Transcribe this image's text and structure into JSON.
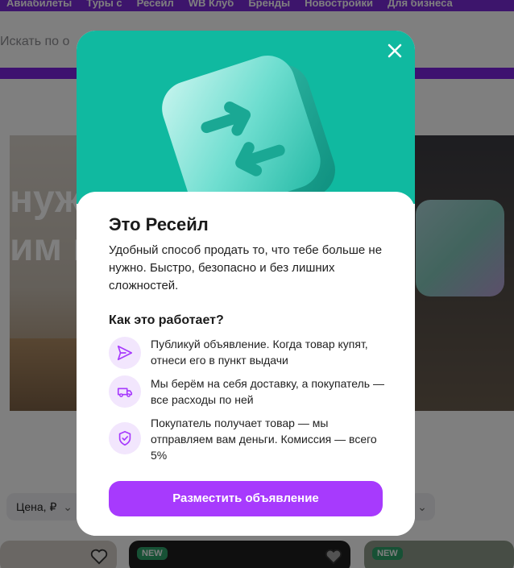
{
  "nav": {
    "items": [
      "Авиабилеты",
      "Туры с",
      "Ресейл",
      "WB Клуб",
      "Бренды",
      "Новостройки",
      "Для бизнеса"
    ]
  },
  "search": {
    "placeholder": "Искать по о"
  },
  "hero": {
    "line1": "нуж",
    "line2": "им в"
  },
  "filters": {
    "price_label": "Цена, ₽"
  },
  "cards": {
    "new_badge": "NEW"
  },
  "modal": {
    "title": "Это Ресейл",
    "description": "Удобный способ продать то, что тебе больше не нужно. Быстро, безопасно и без лишних сложностей.",
    "how_title": "Как это работает?",
    "steps": [
      {
        "icon": "send-icon",
        "text": "Публикуй объявление. Когда товар купят, отнеси его в пункт выдачи"
      },
      {
        "icon": "delivery-truck-icon",
        "text": "Мы берём на себя доставку, а покупатель — все расходы по ней"
      },
      {
        "icon": "shield-check-icon",
        "text": "Покупатель получает товар — мы отправляем вам деньги. Комиссия — всего 5%"
      }
    ],
    "cta_label": "Разместить объявление"
  },
  "colors": {
    "accent": "#a73afd",
    "teal": "#10b9a0",
    "nav": "#7a2ad8",
    "icon_bg": "#f2e6fd",
    "badge_new": "#2ea36b"
  }
}
